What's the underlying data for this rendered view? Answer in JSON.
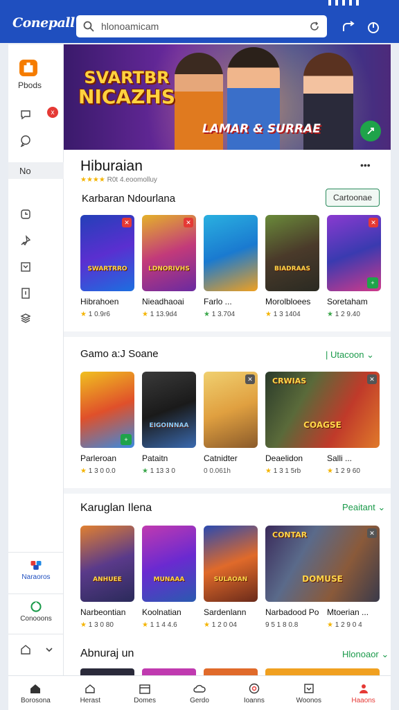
{
  "app": {
    "logo": "Conepall"
  },
  "search": {
    "value": "hlonoamicam"
  },
  "sidebar": {
    "top_label": "Pbods",
    "badge": "x",
    "section_label": "No",
    "bottom_items": [
      {
        "label": "Naraoros"
      },
      {
        "label": "Conooons"
      }
    ]
  },
  "hero": {
    "title_line1": "SVARTBR",
    "title_line2": "NICAZHS",
    "subtitle": "LAMAR & SURRAE"
  },
  "section1": {
    "title": "Hiburaian",
    "rating_text": "R0t 4.eoomolluy",
    "subtitle": "Karbaran Ndourlana",
    "more_button": "Cartoonae",
    "games": [
      {
        "name": "Hibrahoen",
        "rating": "1 0.9r6",
        "art": "SWARTRRO"
      },
      {
        "name": "Nieadhaoai",
        "rating": "1 13.9d4",
        "art": "LDNORIVHS"
      },
      {
        "name": "Farlo ...",
        "rating": "1 3.704",
        "art": ""
      },
      {
        "name": "Morolbloees",
        "rating": "1 3 1404",
        "art": "BIADRAAS"
      },
      {
        "name": "Soretaham",
        "rating": "1 2 9.40",
        "art": ""
      }
    ]
  },
  "section2": {
    "title": "Gamo a:J Soane",
    "link": "Utacoon",
    "games": [
      {
        "name": "Parleroan",
        "rating": "1 3 0 0.0",
        "art": ""
      },
      {
        "name": "Pataitn",
        "rating": "1 13 3 0",
        "art": "EIGOINNAA"
      },
      {
        "name": "Catnidter",
        "rating": "0 0.061h",
        "art": ""
      },
      {
        "name": "Deaelidon",
        "rating": "1 3 1 5rb",
        "art": "CRWIAS"
      },
      {
        "name": "Salli ...",
        "rating": "1 2 9 60",
        "art": "COAGSE"
      }
    ]
  },
  "section3": {
    "title": "Karuglan Ilena",
    "link": "Peaitant",
    "games": [
      {
        "name": "Narbeontian",
        "rating": "1 3 0 80",
        "art": "ANHUEE"
      },
      {
        "name": "Koolnatian",
        "rating": "1 1 4 4.6",
        "art": "MUNAAA"
      },
      {
        "name": "Sardenlann",
        "rating": "1 2 0 04",
        "art": "SULAOAN"
      },
      {
        "name": "Narbadood Po",
        "rating": "9 5 1 8 0.8",
        "art": "CONTAR"
      },
      {
        "name": "Mtoerian ...",
        "rating": "1 2 9 0 4",
        "art": "DOMUSE"
      }
    ]
  },
  "section4": {
    "title": "Abnuraj un",
    "link": "Hlonoaor"
  },
  "bottom_nav": [
    {
      "label": "Borosona",
      "icon": "home-icon"
    },
    {
      "label": "Herast",
      "icon": "house-icon"
    },
    {
      "label": "Domes",
      "icon": "calendar-icon"
    },
    {
      "label": "Gerdo",
      "icon": "cloud-icon"
    },
    {
      "label": "Ioanns",
      "icon": "target-icon"
    },
    {
      "label": "Woonos",
      "icon": "box-icon"
    },
    {
      "label": "Haaons",
      "icon": "user-icon"
    }
  ],
  "colors": {
    "brand": "#1f4fbf",
    "accent_green": "#1a9a4a",
    "star": "#f4b400",
    "active_nav": "#e53935"
  }
}
